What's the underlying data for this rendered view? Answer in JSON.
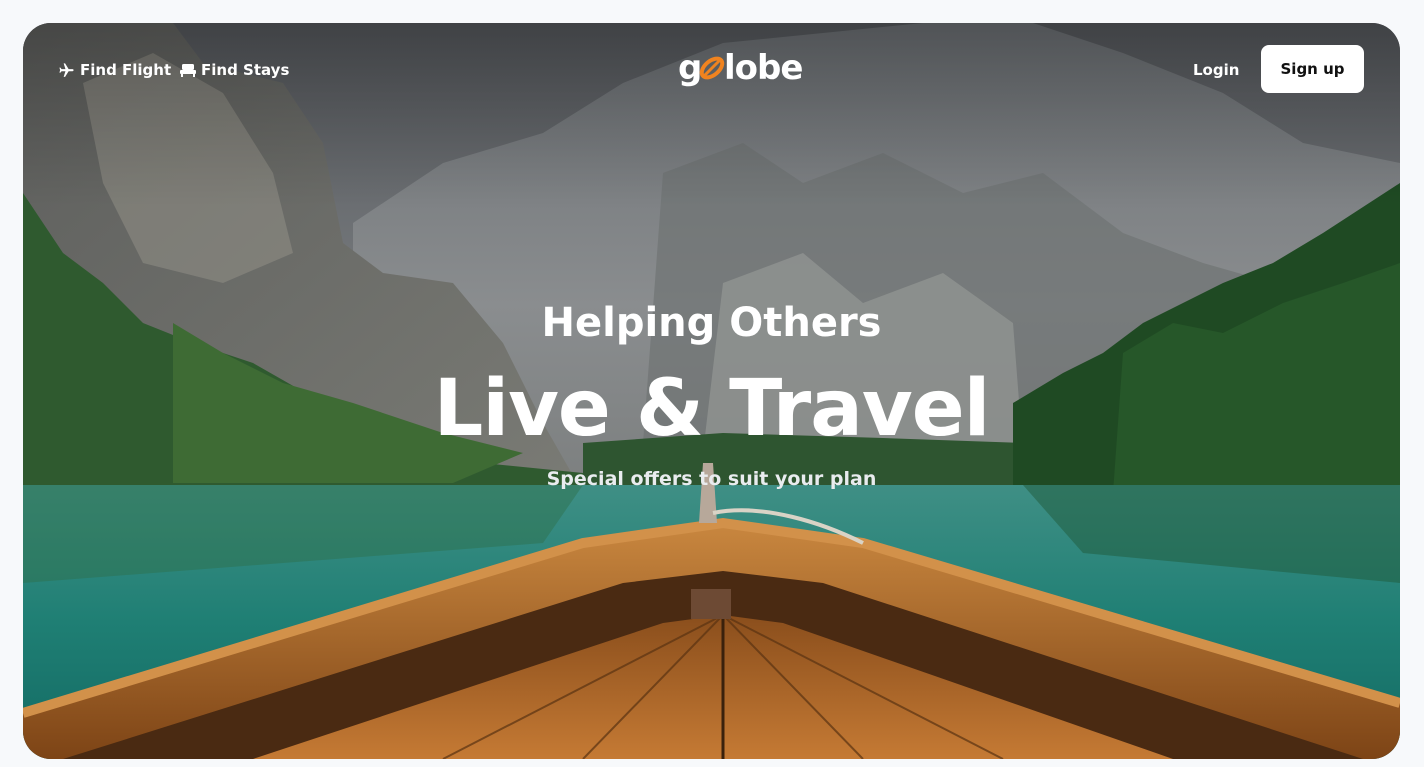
{
  "nav": {
    "find_flight": {
      "label": "Find Flight",
      "icon": "airplane-icon"
    },
    "find_stays": {
      "label": "Find Stays",
      "icon": "bed-icon"
    }
  },
  "logo": {
    "prefix": "g",
    "suffix": "lobe",
    "accent": "#f0831f"
  },
  "auth": {
    "login_label": "Login",
    "signup_label": "Sign up"
  },
  "hero": {
    "subtitle": "Helping Others",
    "title": "Live & Travel",
    "tagline": "Special offers to suit your plan"
  },
  "colors": {
    "page_background": "#f7f9fb",
    "text_on_image": "#ffffff",
    "button_background": "#ffffff",
    "button_text": "#111111",
    "lake": "#1f7f74",
    "boat_wood": "#b36a2a"
  }
}
